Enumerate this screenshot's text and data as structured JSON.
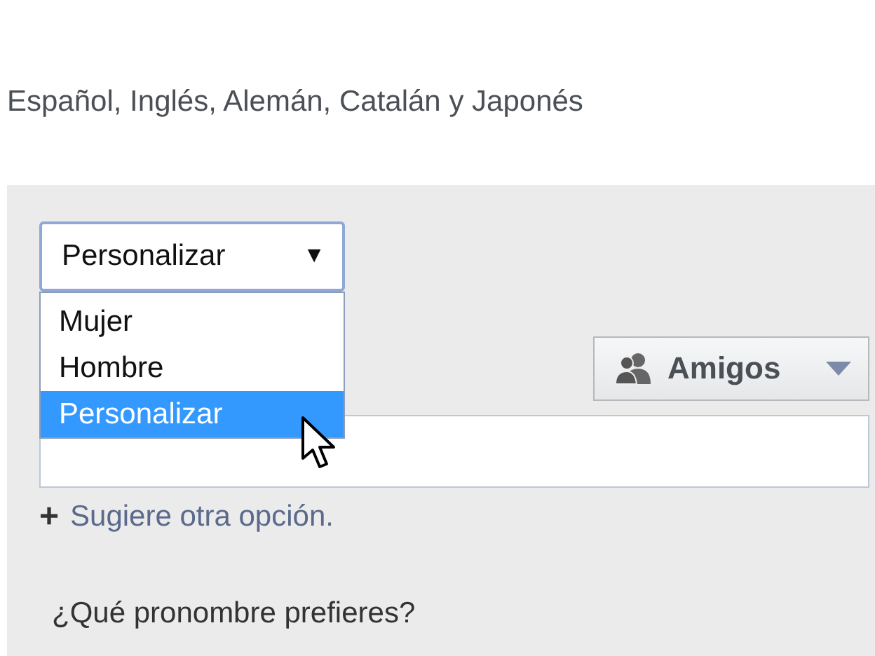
{
  "languages_text": "Español, Inglés, Alemán, Catalán y Japonés",
  "gender_select": {
    "value": "Personalizar",
    "arrow": "▼",
    "expanded": true,
    "options": [
      {
        "label": "Mujer",
        "selected": false
      },
      {
        "label": "Hombre",
        "selected": false
      },
      {
        "label": "Personalizar",
        "selected": true
      }
    ]
  },
  "audience_button": {
    "label": "Amigos"
  },
  "suggest_link": {
    "icon": "+",
    "label": "Sugiere otra opción."
  },
  "pronoun_question": "¿Qué pronombre prefieres?"
}
